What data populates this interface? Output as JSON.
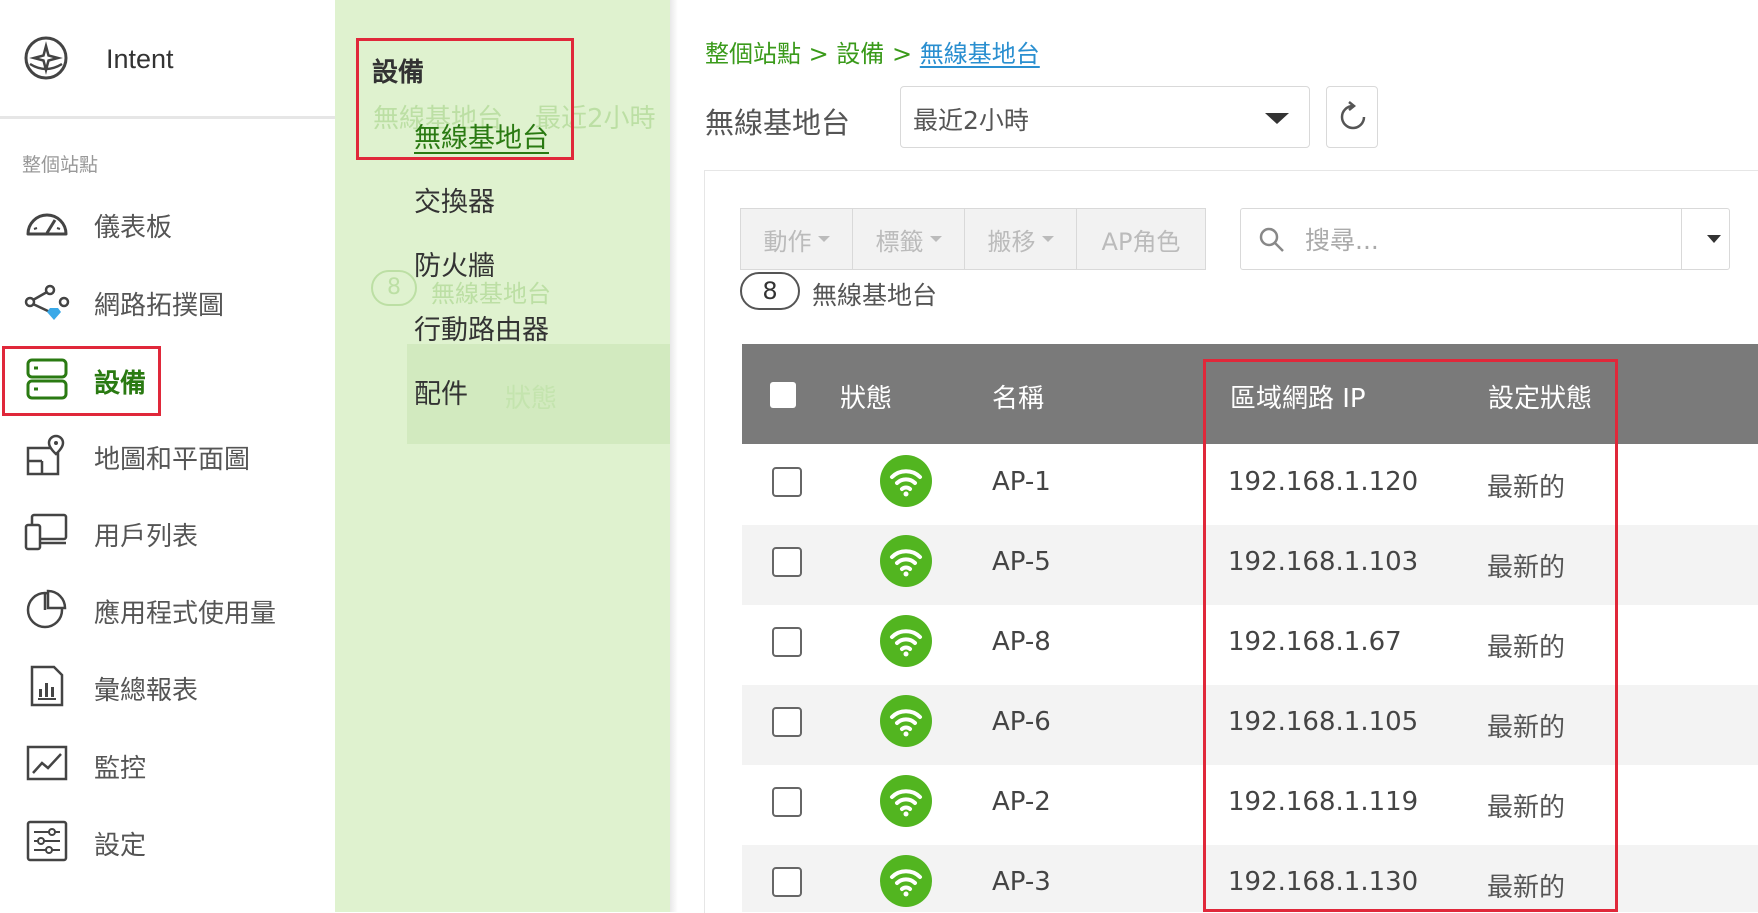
{
  "sidebar": {
    "intent_label": "Intent",
    "site_label": "整個站點",
    "items": [
      {
        "label": "儀表板",
        "icon": "gauge-icon"
      },
      {
        "label": "網路拓撲圖",
        "icon": "topology-icon"
      },
      {
        "label": "設備",
        "icon": "devices-icon",
        "active": true
      },
      {
        "label": "地圖和平面圖",
        "icon": "map-floorplan-icon"
      },
      {
        "label": "用戶列表",
        "icon": "clients-icon"
      },
      {
        "label": "應用程式使用量",
        "icon": "pie-chart-icon"
      },
      {
        "label": "彙總報表",
        "icon": "report-icon"
      },
      {
        "label": "監控",
        "icon": "monitor-icon"
      },
      {
        "label": "設定",
        "icon": "settings-icon"
      }
    ]
  },
  "submenu": {
    "title": "設備",
    "items": [
      {
        "label": "無線基地台",
        "active": true
      },
      {
        "label": "交換器"
      },
      {
        "label": "防火牆"
      },
      {
        "label": "行動路由器"
      },
      {
        "label": "配件"
      }
    ]
  },
  "content": {
    "breadcrumb": {
      "site": "整個站點",
      "sep": ">",
      "devices": "設備",
      "current": "無線基地台"
    },
    "page_title": "無線基地台",
    "time_range": "最近2小時",
    "toolbar": {
      "action": "動作",
      "tag": "標籤",
      "move": "搬移",
      "ap_role": "AP角色"
    },
    "search_placeholder": "搜尋...",
    "count": "8",
    "count_label": "無線基地台",
    "table": {
      "headers": {
        "status": "狀態",
        "name": "名稱",
        "lan_ip": "區域網路 IP",
        "config_status": "設定狀態"
      },
      "rows": [
        {
          "name": "AP-1",
          "ip": "192.168.1.120",
          "config": "最新的"
        },
        {
          "name": "AP-5",
          "ip": "192.168.1.103",
          "config": "最新的"
        },
        {
          "name": "AP-8",
          "ip": "192.168.1.67",
          "config": "最新的"
        },
        {
          "name": "AP-6",
          "ip": "192.168.1.105",
          "config": "最新的"
        },
        {
          "name": "AP-2",
          "ip": "192.168.1.119",
          "config": "最新的"
        },
        {
          "name": "AP-3",
          "ip": "192.168.1.130",
          "config": "最新的"
        }
      ]
    }
  },
  "colors": {
    "accent_green": "#2a7a12",
    "online_green": "#52b520",
    "highlight_red": "#e0283a",
    "submenu_bg": "#dff2cf"
  }
}
